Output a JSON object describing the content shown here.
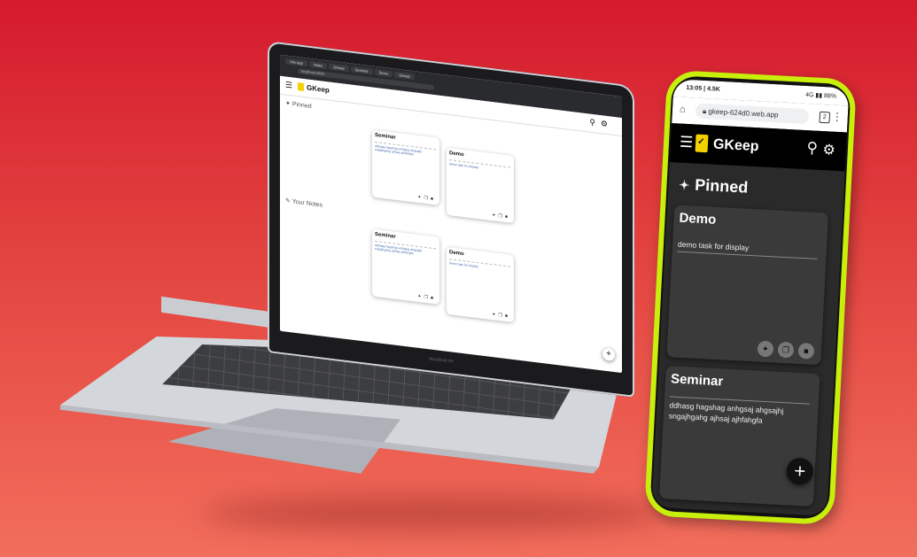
{
  "laptop": {
    "browser_tabs": [
      "Vite App",
      "Notes",
      "GKeep",
      "Seminar",
      "Demo",
      "GKeep"
    ],
    "url": "localhost:3000",
    "app_title": "GKeep",
    "pinned_label": "Pinned",
    "your_notes_label": "Your Notes",
    "pinned_notes": [
      {
        "title": "Seminar",
        "body": "ddhasg hagshag anhgsaj ahgsajhj sngajhgahg ajhsaj ajhfahgfa"
      },
      {
        "title": "Demo",
        "body": "demo task for display"
      }
    ],
    "other_notes": [
      {
        "title": "Seminar",
        "body": "ddhasg hagshag anhgsaj ahgsajhj sngajhgahg ajhsaj ajhfahgfa"
      },
      {
        "title": "Demo",
        "body": "demo task for display"
      }
    ],
    "brand": "MacBook Air",
    "fab": "+"
  },
  "phone": {
    "time": "13:05",
    "status_extra": "4.5K",
    "system_icons": "4G ▮▮ 88%",
    "url": "gkeep-624d0.web.app",
    "tab_count": "2",
    "app_title": "GKeep",
    "pinned_label": "Pinned",
    "notes": [
      {
        "title": "Demo",
        "body": "demo task for display"
      },
      {
        "title": "Seminar",
        "body": "ddhasg hagshag anhgsaj ahgsajhj sngajhgahg ajhsaj ajhfahgfa"
      }
    ],
    "fab": "+"
  },
  "colors": {
    "background_top": "#d51a2e",
    "background_bottom": "#f26e5c",
    "phone_frame": "#c7ef0b",
    "logo_yellow": "#f3d000"
  },
  "icons": [
    "menu-icon",
    "search-icon",
    "gear-icon",
    "pin-icon",
    "edit-icon",
    "copy-icon",
    "delete-icon",
    "plus-icon",
    "lock-icon",
    "home-icon"
  ]
}
